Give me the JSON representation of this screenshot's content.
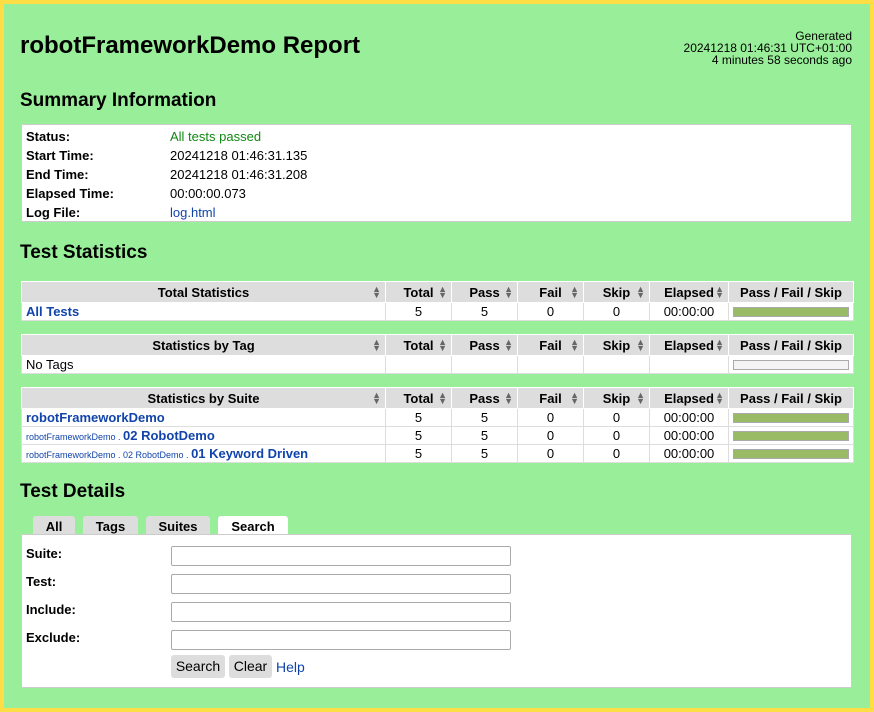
{
  "header": {
    "title": "robotFrameworkDemo Report",
    "generated_label": "Generated",
    "generated_time": "20241218 01:46:31 UTC+01:00",
    "generated_ago": "4 minutes 58 seconds ago"
  },
  "summary": {
    "title": "Summary Information",
    "status_label": "Status:",
    "status_value": "All tests passed",
    "start_label": "Start Time:",
    "start_value": "20241218 01:46:31.135",
    "end_label": "End Time:",
    "end_value": "20241218 01:46:31.208",
    "elapsed_label": "Elapsed Time:",
    "elapsed_value": "00:00:00.073",
    "log_label": "Log File:",
    "log_value": "log.html"
  },
  "statistics": {
    "title": "Test Statistics",
    "columns": [
      "Total",
      "Pass",
      "Fail",
      "Skip",
      "Elapsed",
      "Pass / Fail / Skip"
    ],
    "total": {
      "header": "Total Statistics",
      "rows": [
        {
          "name": "All Tests",
          "total": "5",
          "pass": "5",
          "fail": "0",
          "skip": "0",
          "elapsed": "00:00:00"
        }
      ]
    },
    "tag": {
      "header": "Statistics by Tag",
      "rows": [
        {
          "name": "No Tags",
          "total": "",
          "pass": "",
          "fail": "",
          "skip": "",
          "elapsed": ""
        }
      ]
    },
    "suite": {
      "header": "Statistics by Suite",
      "rows": [
        {
          "prefix": "",
          "name": "robotFrameworkDemo",
          "total": "5",
          "pass": "5",
          "fail": "0",
          "skip": "0",
          "elapsed": "00:00:00"
        },
        {
          "prefix": "robotFrameworkDemo . ",
          "name": "02 RobotDemo",
          "total": "5",
          "pass": "5",
          "fail": "0",
          "skip": "0",
          "elapsed": "00:00:00"
        },
        {
          "prefix": "robotFrameworkDemo . 02 RobotDemo . ",
          "name": "01 Keyword Driven",
          "total": "5",
          "pass": "5",
          "fail": "0",
          "skip": "0",
          "elapsed": "00:00:00"
        }
      ]
    },
    "pass_fraction": 1.0
  },
  "details": {
    "title": "Test Details",
    "tabs": [
      "All",
      "Tags",
      "Suites",
      "Search"
    ],
    "active_tab": "Search",
    "suite_label": "Suite:",
    "suite_value": "",
    "test_label": "Test:",
    "test_value": "",
    "include_label": "Include:",
    "include_value": "",
    "exclude_label": "Exclude:",
    "exclude_value": "",
    "search_button": "Search",
    "clear_button": "Clear",
    "help_link": "Help"
  },
  "colors": {
    "background": "#99ee99",
    "border": "#ffdd44",
    "pass_bar": "#99bb66",
    "link": "#1144aa",
    "status_green": "#118811"
  },
  "icons": {
    "sort": "sort-arrows-icon"
  }
}
